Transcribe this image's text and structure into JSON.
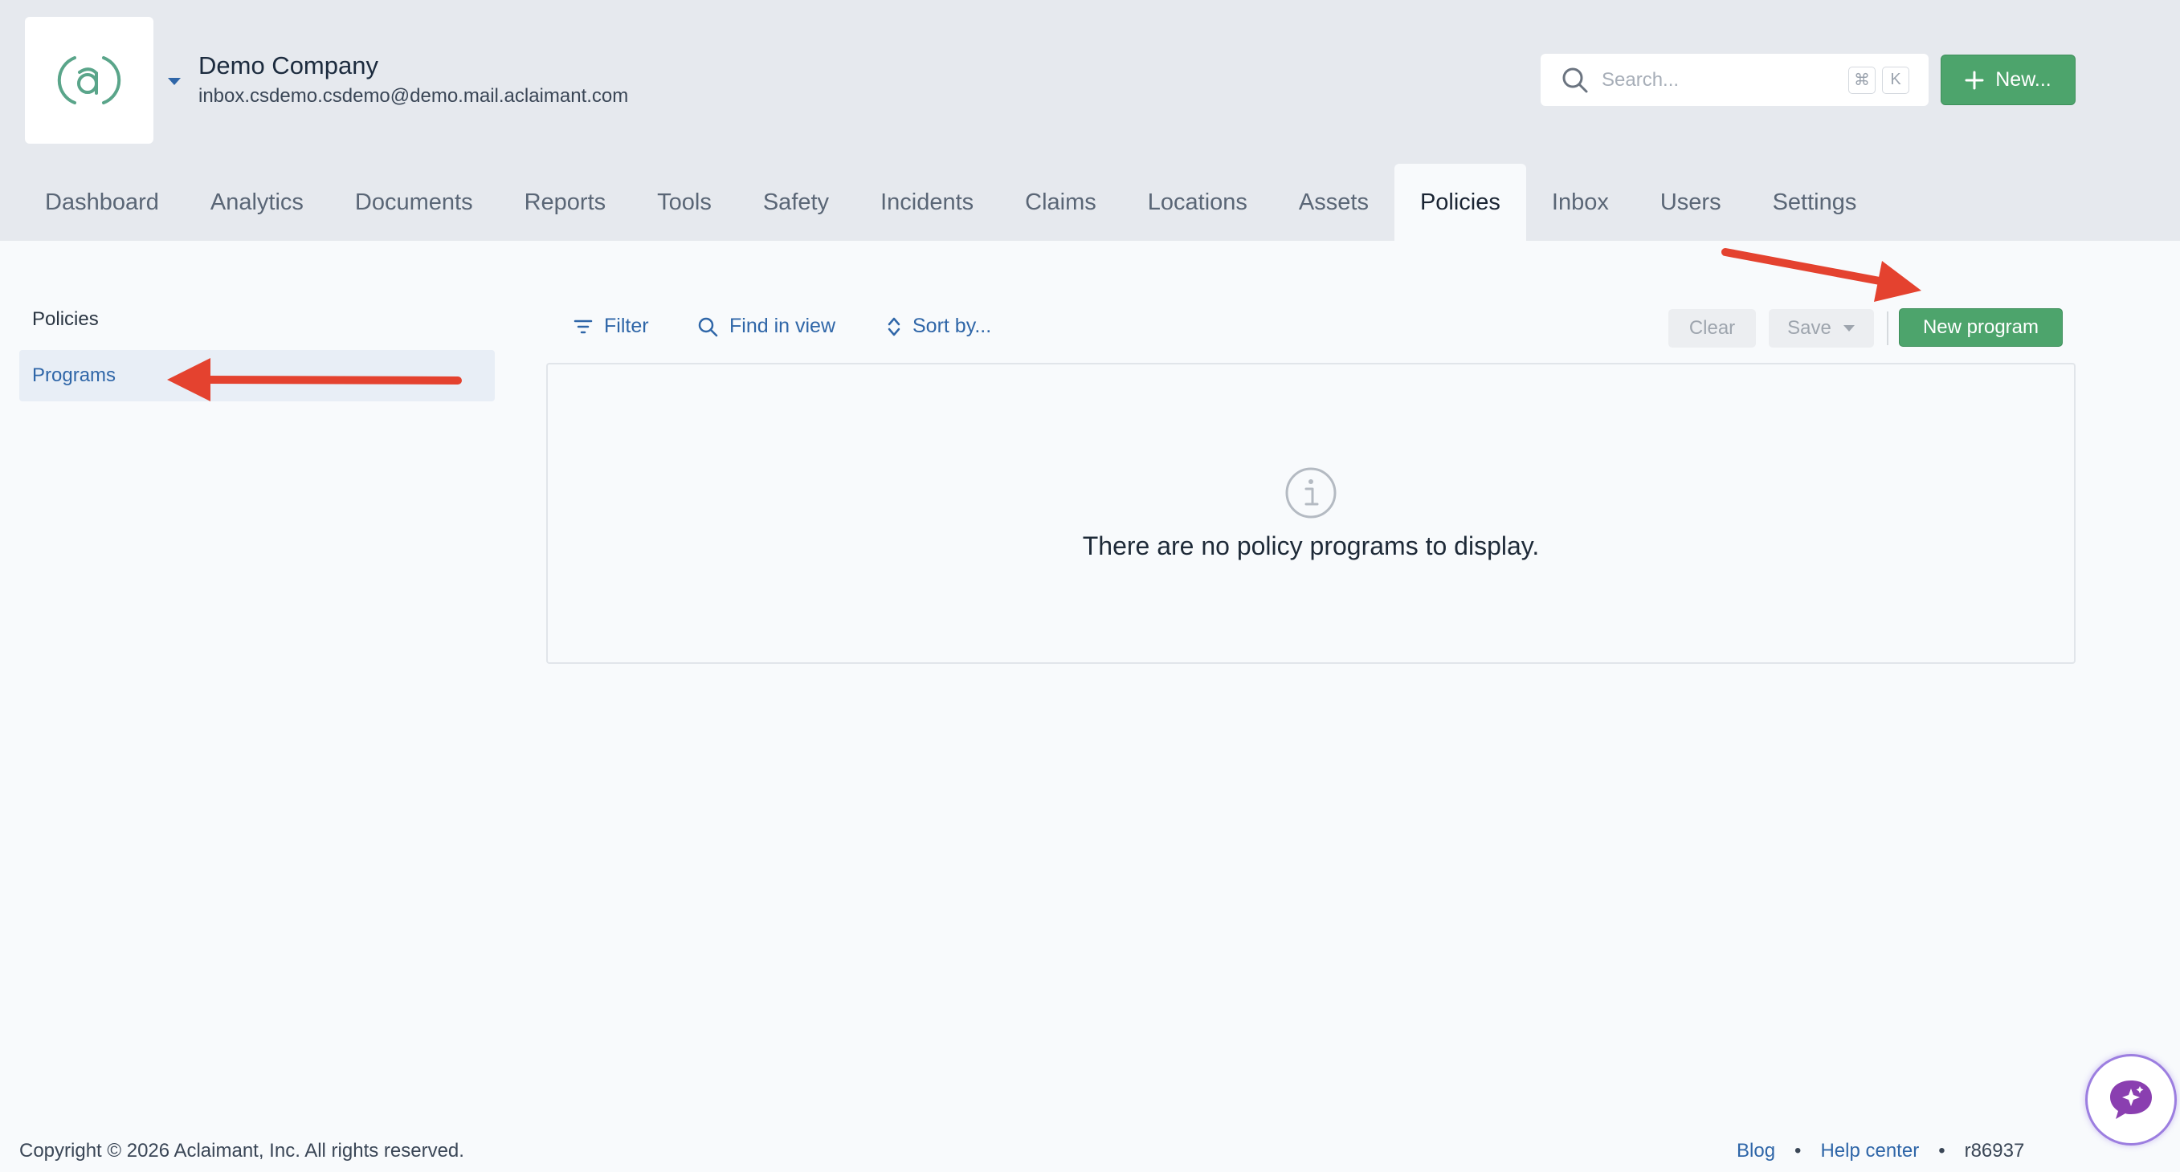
{
  "header": {
    "logo_text": "(a)",
    "company_name": "Demo Company",
    "company_email": "inbox.csdemo.csdemo@demo.mail.aclaimant.com",
    "search": {
      "placeholder": "Search...",
      "shortcut_keys": [
        "⌘",
        "K"
      ]
    },
    "new_button_label": "New..."
  },
  "tabs": [
    {
      "label": "Dashboard",
      "active": false
    },
    {
      "label": "Analytics",
      "active": false
    },
    {
      "label": "Documents",
      "active": false
    },
    {
      "label": "Reports",
      "active": false
    },
    {
      "label": "Tools",
      "active": false
    },
    {
      "label": "Safety",
      "active": false
    },
    {
      "label": "Incidents",
      "active": false
    },
    {
      "label": "Claims",
      "active": false
    },
    {
      "label": "Locations",
      "active": false
    },
    {
      "label": "Assets",
      "active": false
    },
    {
      "label": "Policies",
      "active": true
    },
    {
      "label": "Inbox",
      "active": false
    },
    {
      "label": "Users",
      "active": false
    },
    {
      "label": "Settings",
      "active": false
    }
  ],
  "sidebar": {
    "title": "Policies",
    "items": [
      {
        "label": "Programs",
        "selected": true
      }
    ]
  },
  "toolbar": {
    "filter_label": "Filter",
    "find_label": "Find in view",
    "sort_label": "Sort by...",
    "clear_label": "Clear",
    "save_label": "Save",
    "new_program_label": "New program"
  },
  "empty_state": {
    "message": "There are no policy programs to display."
  },
  "footer": {
    "copyright": "Copyright © 2026 Aclaimant, Inc. All rights reserved.",
    "links": [
      "Blog",
      "Help center"
    ],
    "separator": "•",
    "revision": "r86937"
  },
  "colors": {
    "header_bg": "#e6e9ee",
    "page_bg": "#f8fafc",
    "brand_green": "#4da46c",
    "link_blue": "#2f66a8",
    "annotation_red": "#e4422f",
    "chat_purple": "#8a3fb0"
  },
  "icons": {
    "logo": "aclaimant-logo",
    "caret": "caret-down-icon",
    "search": "search-icon",
    "new": "plus-icon",
    "filter": "filter-icon",
    "find": "magnifier-icon",
    "sort": "sort-arrows-icon",
    "save_dropdown": "caret-down-icon",
    "empty": "info-circle-icon",
    "chat": "ai-chat-sparkle-icon"
  }
}
